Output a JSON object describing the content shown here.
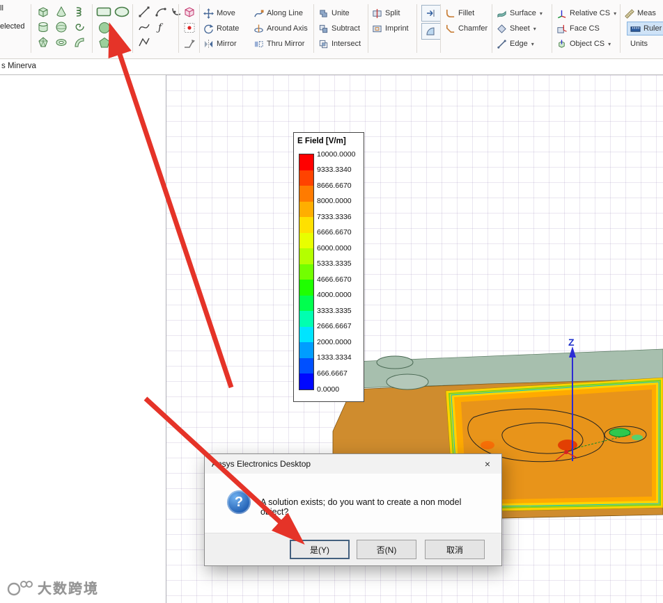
{
  "toolbar": {
    "partial_left": {
      "line1": "ll",
      "line2": "elected"
    },
    "groups": {
      "transform": {
        "move": "Move",
        "rotate": "Rotate",
        "mirror": "Mirror"
      },
      "sweep": {
        "along_line": "Along Line",
        "around_axis": "Around Axis",
        "thru_mirror": "Thru Mirror"
      },
      "boolean": {
        "unite": "Unite",
        "subtract": "Subtract",
        "intersect": "Intersect"
      },
      "split_group": {
        "split": "Split",
        "imprint": "Imprint"
      },
      "fillet_group": {
        "fillet": "Fillet",
        "chamfer": "Chamfer"
      },
      "surface_group": {
        "surface": "Surface",
        "sheet": "Sheet",
        "edge": "Edge"
      },
      "cs_group": {
        "relative_cs": "Relative CS",
        "face_cs": "Face CS",
        "object_cs": "Object CS"
      },
      "measure_group": {
        "measure": "Meas",
        "ruler": "Ruler",
        "units": "Units"
      }
    }
  },
  "icons": {
    "dropdown": "▾",
    "close": "×"
  },
  "titlebar": {
    "text": "s Minerva"
  },
  "legend": {
    "title": "E Field [V/m]",
    "values": [
      "10000.0000",
      "9333.3340",
      "8666.6670",
      "8000.0000",
      "7333.3336",
      "6666.6670",
      "6000.0000",
      "5333.3335",
      "4666.6670",
      "4000.0000",
      "3333.3335",
      "2666.6667",
      "2000.0000",
      "1333.3334",
      "666.6667",
      "0.0000"
    ],
    "colors": [
      "#ff0000",
      "#ff4300",
      "#ff7b00",
      "#ffae00",
      "#ffe000",
      "#e8ff00",
      "#b4ff00",
      "#72ff00",
      "#1fff00",
      "#00ff4e",
      "#00ffb0",
      "#00e4ff",
      "#009dff",
      "#0050ff",
      "#0008ff"
    ]
  },
  "viewport": {
    "z_axis_label": "Z"
  },
  "dialog": {
    "title": "Ansys Electronics Desktop",
    "help_glyph": "?",
    "message": "A solution exists; do you want to create a non model object?",
    "buttons": {
      "yes": "是(Y)",
      "no": "否(N)",
      "cancel": "取消"
    }
  },
  "watermark": {
    "text": "大数跨境"
  },
  "colors": {
    "annotation_arrow": "#e53328",
    "ruler_highlight": "#cfe3f7",
    "board_orange": "#cf8c2e",
    "axis_blue": "#2b2bd5"
  }
}
